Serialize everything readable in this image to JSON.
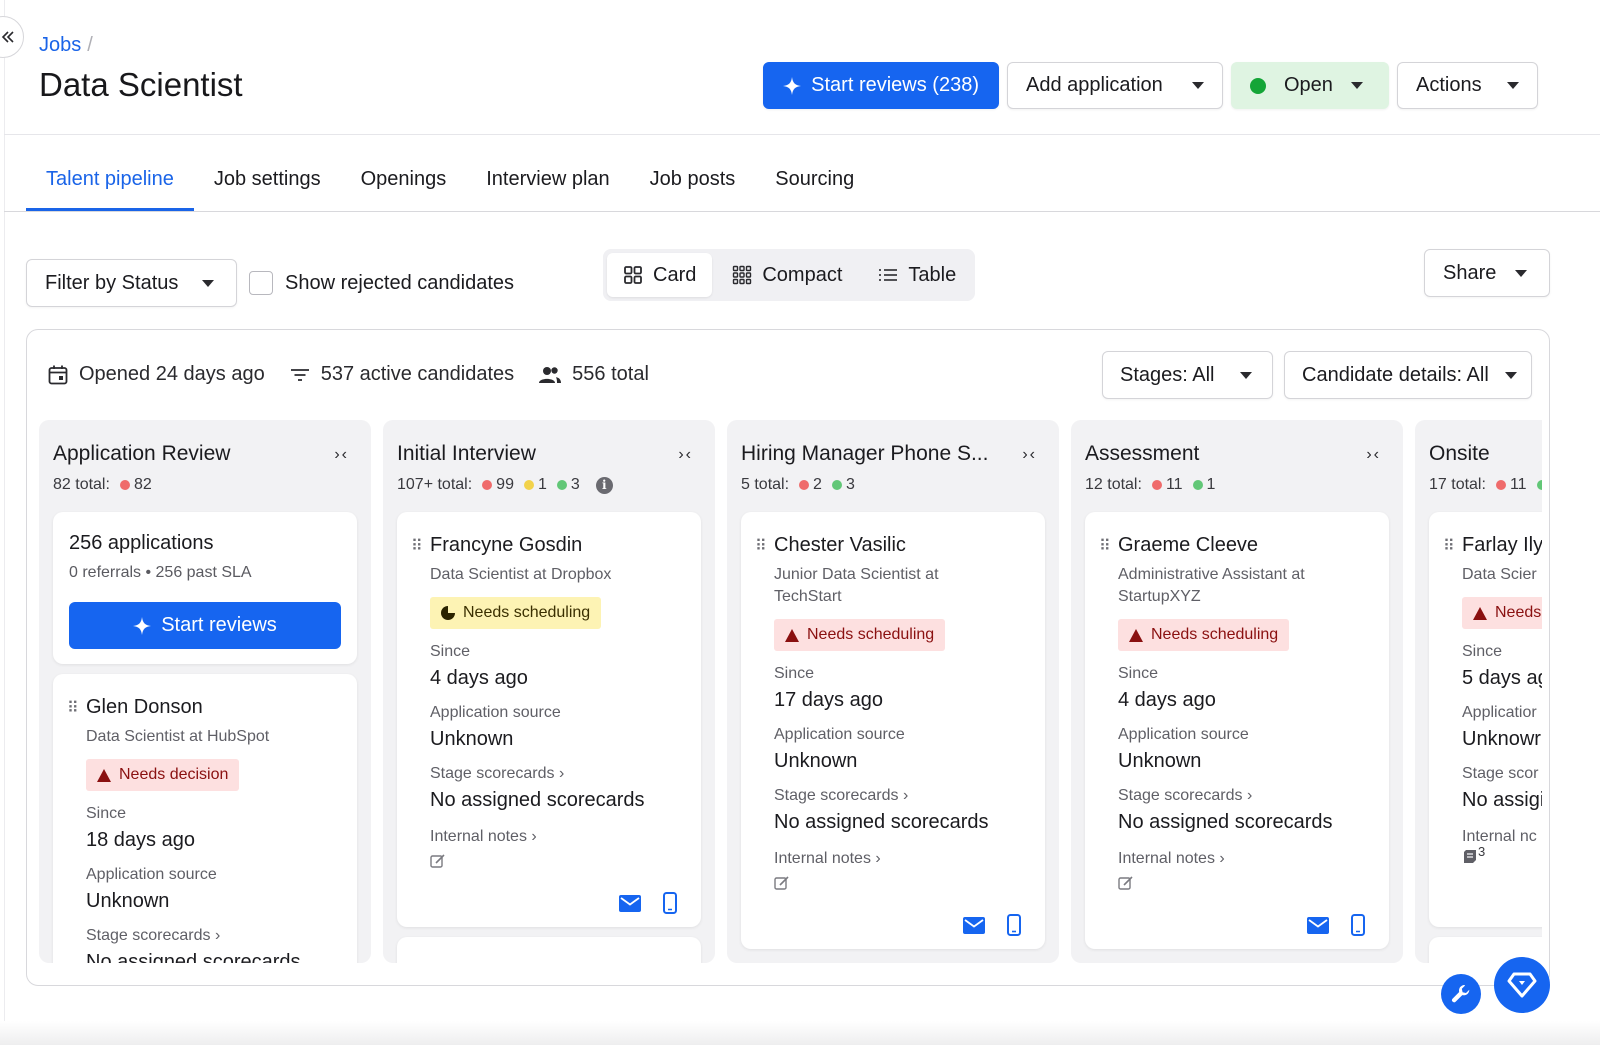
{
  "header": {
    "breadcrumb": "Jobs",
    "breadcrumb_sep": "/",
    "title": "Data Scientist",
    "start_reviews": "Start reviews (238)",
    "add_application": "Add application",
    "status": "Open",
    "actions": "Actions"
  },
  "tabs": [
    "Talent pipeline",
    "Job settings",
    "Openings",
    "Interview plan",
    "Job posts",
    "Sourcing"
  ],
  "toolbar": {
    "filter": "Filter by Status",
    "show_rejected": "Show rejected candidates",
    "views": [
      "Card",
      "Compact",
      "Table"
    ],
    "active_view": "Card",
    "share": "Share"
  },
  "board": {
    "opened": "Opened 24 days ago",
    "active": "537 active candidates",
    "total": "556 total",
    "stages_filter": "Stages: All",
    "details_filter": "Candidate details: All"
  },
  "labels": {
    "since": "Since",
    "source": "Application source",
    "scorecards": "Stage scorecards ›",
    "notes": "Internal notes ›"
  },
  "columns": [
    {
      "title": "Application Review",
      "total": "82 total:",
      "counts": {
        "red": "82"
      },
      "summary": {
        "title": "256 applications",
        "sub": "0 referrals  •  256 past SLA",
        "button": "Start reviews"
      },
      "card": {
        "name": "Glen Donson",
        "role": "Data Scientist at HubSpot",
        "badge": "Needs decision",
        "since": "18 days ago",
        "source": "Unknown",
        "scorecards": "No assigned scorecards"
      }
    },
    {
      "title": "Initial Interview",
      "total": "107+ total:",
      "counts": {
        "red": "99",
        "yellow": "1",
        "green": "3"
      },
      "card": {
        "name": "Francyne Gosdin",
        "role": "Data Scientist at Dropbox",
        "badge": "Needs scheduling",
        "since": "4 days ago",
        "source": "Unknown",
        "scorecards": "No assigned scorecards"
      }
    },
    {
      "title": "Hiring Manager Phone S...",
      "total": "5 total:",
      "counts": {
        "red": "2",
        "green": "3"
      },
      "card": {
        "name": "Chester Vasilic",
        "role": "Junior Data Scientist at TechStart",
        "badge": "Needs scheduling",
        "since": "17 days ago",
        "source": "Unknown",
        "scorecards": "No assigned scorecards"
      }
    },
    {
      "title": "Assessment",
      "total": "12 total:",
      "counts": {
        "red": "11",
        "green": "1"
      },
      "card": {
        "name": "Graeme Cleeve",
        "role": "Administrative Assistant at StartupXYZ",
        "badge": "Needs scheduling",
        "since": "4 days ago",
        "source": "Unknown",
        "scorecards": "No assigned scorecards"
      }
    },
    {
      "title": "Onsite",
      "total": "17 total:",
      "counts": {
        "red": "11"
      },
      "card": {
        "name": "Farlay Ily",
        "role": "Data Scier",
        "badge": "Needs",
        "since": "5 days ag",
        "source": "Unknowr",
        "scorecards_label": "Stage scor",
        "scorecards": "No assigi",
        "notes_label": "Internal nc",
        "notes_count": "3"
      }
    }
  ]
}
